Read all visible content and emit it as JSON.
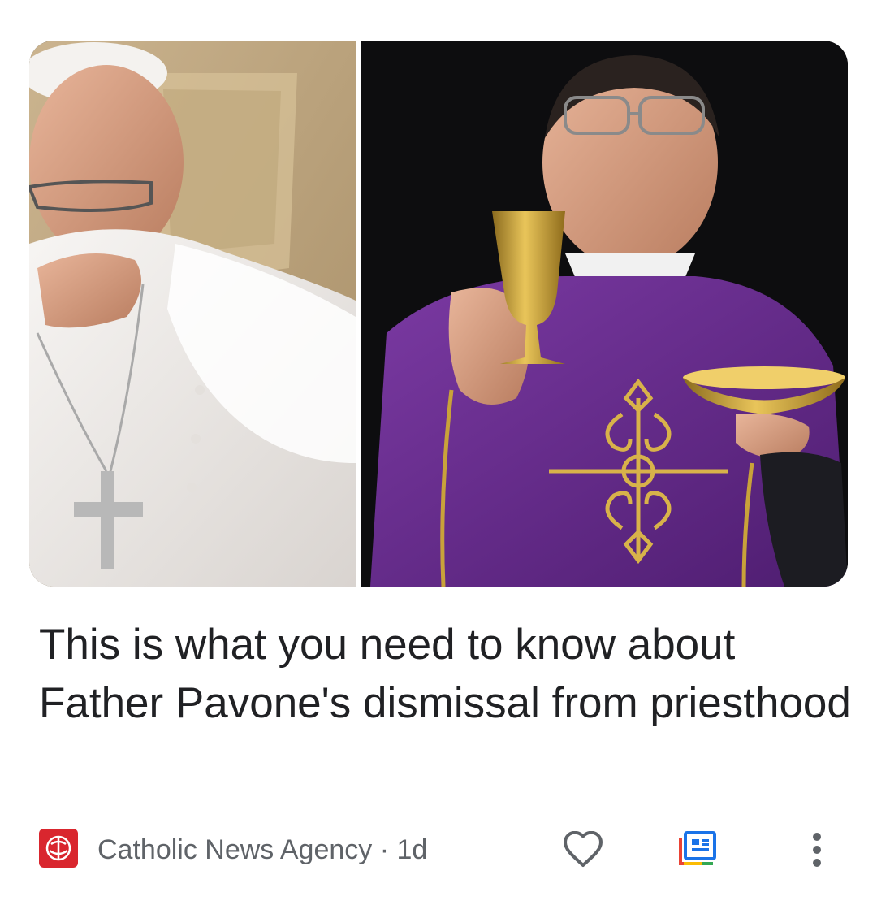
{
  "article": {
    "headline": "This is what you need to know about Father Pavone's dismissal from priesthood",
    "image_alt": "Side-by-side photos: Pope Francis seated in white vestments with hand to his face; a priest in purple vestments raising a gold chalice and paten"
  },
  "meta": {
    "source": "Catholic News Agency",
    "separator": " · ",
    "age": "1d",
    "source_logo_color": "#d9262e"
  },
  "actions": {
    "like_icon": "heart-outline-icon",
    "full_coverage_icon": "full-coverage-icon",
    "more_icon": "more-vertical-icon"
  },
  "colors": {
    "text_primary": "#202124",
    "text_secondary": "#5f6368",
    "vestment_purple": "#6a2a8e",
    "gold": "#c9a23a"
  }
}
